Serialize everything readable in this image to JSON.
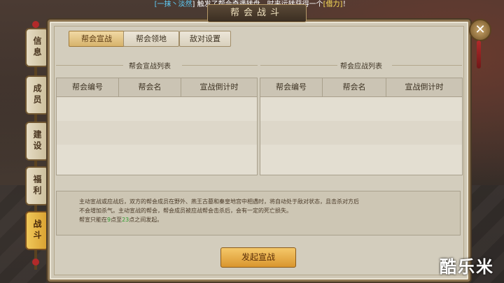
{
  "notice": {
    "prefix": "[一抹丶",
    "user": "淡然",
    "suffix": "] 触发了帮会奇遇转盘，时来运转获得一个",
    "item": "[借力]",
    "end": "！"
  },
  "panel": {
    "title": "帮会战斗",
    "close_label": "✕"
  },
  "side_tabs": [
    {
      "label": "信息"
    },
    {
      "label": "成员"
    },
    {
      "label": "建设"
    },
    {
      "label": "福利"
    },
    {
      "label": "战斗"
    }
  ],
  "tabs": [
    {
      "label": "帮会宣战"
    },
    {
      "label": "帮会领地"
    },
    {
      "label": "敌对设置"
    }
  ],
  "left_list": {
    "title": "帮会宣战列表",
    "columns": [
      "帮会编号",
      "帮会名",
      "宣战倒计时"
    ]
  },
  "right_list": {
    "title": "帮会应战列表",
    "columns": [
      "帮会编号",
      "帮会名",
      "宣战倒计时"
    ]
  },
  "info": {
    "line1": "主动宣战或应战后，双方的帮会成员在野外、燕王古墓和秦皇地宫中相遇时，将自动处于敌对状态，且击杀对方后",
    "line2": "不会增加杀气。主动宣战的帮会，帮会成员被应战帮会击杀后，会有一定的死亡损失。",
    "line3_a": "帮宣只能在",
    "line3_b": "9",
    "line3_c": "点至",
    "line3_d": "23",
    "line3_e": "点之间发起。"
  },
  "action_button": "发起宣战",
  "watermark": "酷乐米"
}
